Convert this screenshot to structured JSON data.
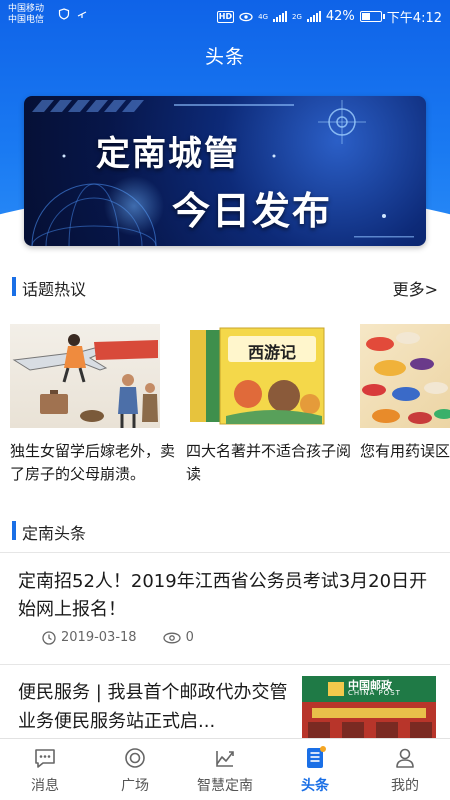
{
  "status_bar": {
    "carrier_1": "中国移动",
    "carrier_2": "中国电信",
    "hd": "HD",
    "network": "4G",
    "network_2": "2G",
    "battery": "42%",
    "battery_level": 0.42,
    "time": "下午4:12"
  },
  "header": {
    "title": "头条"
  },
  "banner": {
    "line1": "定南城管",
    "line2": "今日发布"
  },
  "topics_section": {
    "title": "话题热议",
    "more": "更多>",
    "items": [
      {
        "text": "独生女留学后嫁老外，卖了房子的父母崩溃。",
        "image": "travel-illustration"
      },
      {
        "text": "四大名著并不适合孩子阅读",
        "image": "book-cover",
        "image_label": "西游记"
      },
      {
        "text": "您有用药误区",
        "image": "pills-photo"
      }
    ]
  },
  "news_section": {
    "title": "定南头条",
    "items": [
      {
        "title": "定南招52人！2019年江西省公务员考试3月20日开始网上报名！",
        "date": "2019-03-18",
        "views": "0"
      },
      {
        "title": "便民服务 | 我县首个邮政代办交管业务便民服务站正式启...",
        "image": "post-office-photo",
        "image_label": "中国邮政",
        "image_label_en": "CHINA POST"
      }
    ]
  },
  "bottom_nav": {
    "items": [
      {
        "label": "消息",
        "icon": "message-icon"
      },
      {
        "label": "广场",
        "icon": "plaza-icon"
      },
      {
        "label": "智慧定南",
        "icon": "smart-city-icon"
      },
      {
        "label": "头条",
        "icon": "headline-icon",
        "active": true
      },
      {
        "label": "我的",
        "icon": "profile-icon"
      }
    ],
    "active_color": "#1a6fe6"
  },
  "colors": {
    "header_blue": "#1a7af2",
    "accent": "#1a6fe6"
  }
}
